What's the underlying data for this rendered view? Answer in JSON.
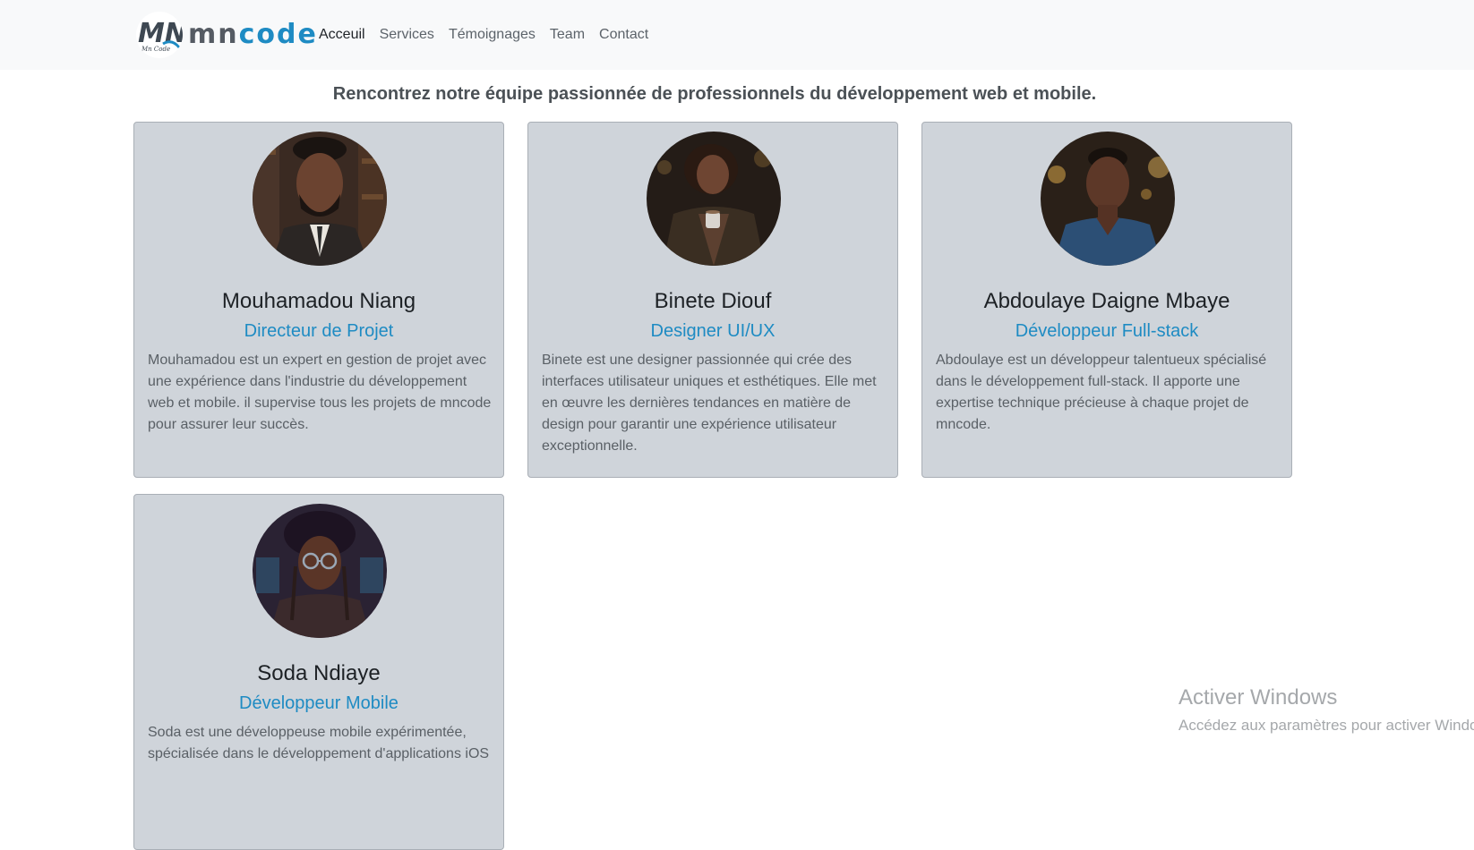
{
  "brand": {
    "name_part1": "mn",
    "name_part2": "code",
    "logo_text": "MN",
    "logo_subtext": "Mn Code"
  },
  "nav": {
    "items": [
      {
        "label": "Acceuil",
        "active": true
      },
      {
        "label": "Services",
        "active": false
      },
      {
        "label": "Témoignages",
        "active": false
      },
      {
        "label": "Team",
        "active": false
      },
      {
        "label": "Contact",
        "active": false
      }
    ]
  },
  "intro": "Rencontrez notre équipe passionnée de professionnels du développement web et mobile.",
  "team": [
    {
      "name": "Mouhamadou Niang",
      "role": "Directeur de Projet",
      "description": "Mouhamadou est un expert en gestion de projet avec une expérience dans l'industrie du développement web et mobile. il supervise tous les projets de mncode pour assurer leur succès.",
      "avatar_icon": "man-in-suit-portrait"
    },
    {
      "name": "Binete Diouf",
      "role": "Designer UI/UX",
      "description": "Binete est une designer passionnée qui crée des interfaces utilisateur uniques et esthétiques. Elle met en œuvre les dernières tendances en matière de design pour garantir une expérience utilisateur exceptionnelle.",
      "avatar_icon": "woman-with-coffee-portrait"
    },
    {
      "name": "Abdoulaye Daigne Mbaye",
      "role": "Développeur Full-stack",
      "description": "Abdoulaye est un développeur talentueux spécialisé dans le développement full-stack. Il apporte une expertise technique précieuse à chaque projet de mncode.",
      "avatar_icon": "man-in-blue-shirt-portrait"
    },
    {
      "name": "Soda Ndiaye",
      "role": "Développeur Mobile",
      "description": "Soda est une développeuse mobile expérimentée, spécialisée dans le développement d'applications iOS",
      "avatar_icon": "woman-with-glasses-portrait"
    }
  ],
  "watermark": {
    "title": "Activer Windows",
    "subtitle": "Accédez aux paramètres pour activer Windows."
  },
  "colors": {
    "accent": "#1e8bc3",
    "card_bg": "#cfd4da",
    "navbar_bg": "#f8f9fa"
  }
}
